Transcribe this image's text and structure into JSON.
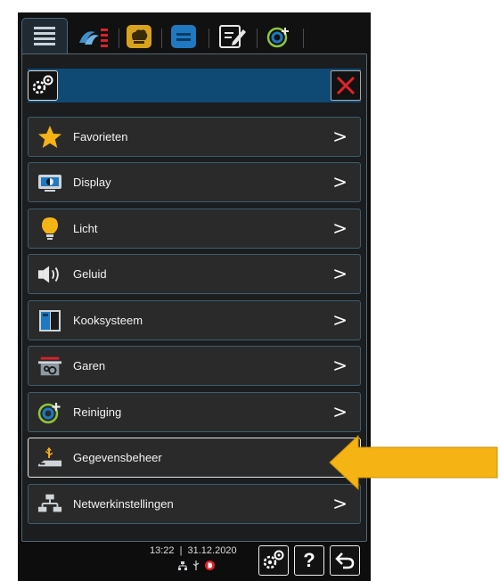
{
  "tabs": [
    {
      "icon": "menu-list-icon",
      "active": true
    },
    {
      "icon": "cooking-icon",
      "active": false
    },
    {
      "icon": "chef-hat-icon",
      "active": false
    },
    {
      "icon": "note-icon",
      "active": false
    },
    {
      "icon": "edit-icon",
      "active": false
    },
    {
      "icon": "cleaning-icon",
      "active": false
    }
  ],
  "header": {
    "gear_icon": "gears-icon",
    "close_icon": "close-icon"
  },
  "menu": {
    "items": [
      {
        "label": "Favorieten",
        "icon": "star-icon"
      },
      {
        "label": "Display",
        "icon": "display-icon"
      },
      {
        "label": "Licht",
        "icon": "bulb-icon"
      },
      {
        "label": "Geluid",
        "icon": "speaker-icon"
      },
      {
        "label": "Kooksysteem",
        "icon": "cooking-system-icon"
      },
      {
        "label": "Garen",
        "icon": "pot-icon"
      },
      {
        "label": "Reiniging",
        "icon": "cleaning-icon"
      },
      {
        "label": "Gegevensbeheer",
        "icon": "usb-data-icon"
      },
      {
        "label": "Netwerkinstellingen",
        "icon": "network-icon"
      }
    ]
  },
  "footer": {
    "time": "13:22",
    "date": "31.12.2020",
    "help_label": "?"
  },
  "colors": {
    "accent": "#0f4a74",
    "highlight_arrow": "#f5b414",
    "close_red": "#e2232a",
    "star": "#f6b315"
  }
}
